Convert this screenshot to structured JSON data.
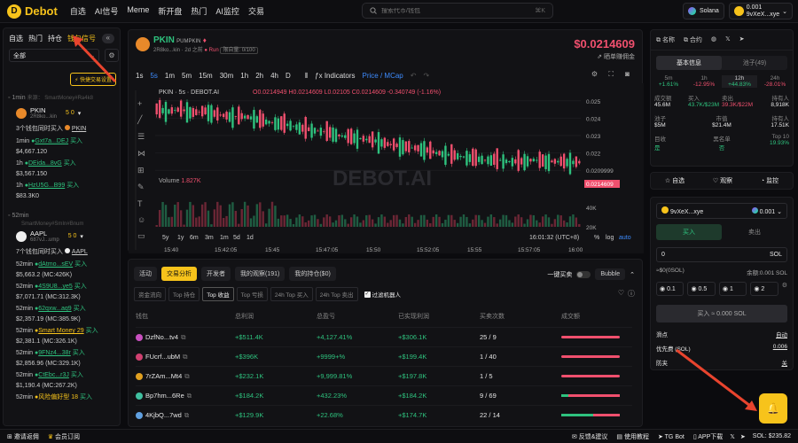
{
  "header": {
    "logo": "Debot",
    "nav": [
      "自选",
      "AI信号",
      "Meme",
      "新开盘",
      "热门",
      "AI监控",
      "交易"
    ],
    "search_placeholder": "搜索代币/钱包",
    "search_kbd": "⌘K",
    "chain": "Solana",
    "wallet_balance": "0.001",
    "wallet_addr": "9vXeX...xye"
  },
  "left": {
    "tabs": [
      "自选",
      "热门",
      "持仓",
      "钱包信号"
    ],
    "toggle": "«",
    "select": "全部",
    "fast_btn": "快捷交易设置",
    "sections": [
      {
        "time": "1min",
        "sub": "来源： SmartMoney#Ra4k8",
        "token": "PKIN",
        "addr": "2R8ko...kin",
        "badge": "5 0",
        "summary": "3个钱包同时买入",
        "summary_token": "PKIN",
        "entries": [
          {
            "t": "1min",
            "w": "Gxt7a...DEJ",
            "a": "买入",
            "amt": "$4,667.120"
          },
          {
            "t": "1h",
            "w": "DEida...8vG",
            "a": "买入",
            "amt": "$3,567.150"
          },
          {
            "t": "1h",
            "w": "HzU5G...B99",
            "a": "买入",
            "amt": "$83.3K0"
          }
        ]
      },
      {
        "time": "52min",
        "sub": "SmartMoney#SmIn#Bnum",
        "token": "AAPL",
        "addr": "687vJ...ump",
        "badge": "5 0",
        "summary": "7个钱包同时买入",
        "summary_token": "AAPL",
        "entries": [
          {
            "t": "52min",
            "w": "dAtmo...sEV",
            "a": "买入",
            "amt": "$5,663.2 (MC:426K)"
          },
          {
            "t": "52min",
            "w": "4S9U8...ye5",
            "a": "买入",
            "amt": "$7,071.71 (MC:312.3K)"
          },
          {
            "t": "52min",
            "w": "62qxw...aq9",
            "a": "买入",
            "amt": "$2,357.19 (MC:385.9K)"
          },
          {
            "t": "52min",
            "w": "Smart Money 29",
            "a": "买入",
            "amt": "$2,381.1 (MC:326.1K)"
          },
          {
            "t": "52min",
            "w": "9FNz4...38r",
            "a": "买入",
            "amt": "$2,856.96 (MC:329.1K)"
          },
          {
            "t": "52min",
            "w": "CtEbc...r3J",
            "a": "买入",
            "amt": "$1,190.4 (MC:267.2K)"
          },
          {
            "t": "52min",
            "w": "风险偏好型 18",
            "a": "买入",
            "amt": ""
          }
        ]
      }
    ]
  },
  "chart": {
    "token": "PKIN",
    "name": "PUMPKIN",
    "age": "2d 之前",
    "addr": "2R8ko...kin",
    "run": "Run",
    "holders_tag": "限自量: 0/100",
    "price": "$0.0214609",
    "rebate": "晒单赚佣金",
    "timeframes": [
      "1s",
      "5s",
      "1m",
      "5m",
      "15m",
      "30m",
      "1h",
      "2h",
      "4h",
      "D"
    ],
    "active_tf": "5s",
    "indicators": "Indicators",
    "price_mcap": "Price / MCap",
    "ohlc_label": "PKIN · 5s · DEBOT.AI",
    "o": "0.0214949",
    "h": "0.0214609",
    "l": "0.02105",
    "c": "0.0214609",
    "chg": "-0.340749 (-1.16%)",
    "watermark": "DEBOT.AI",
    "volume_label": "Volume",
    "volume_val": "1.827K",
    "ymax": "0.025",
    "yticks": [
      "0.025",
      "0.024",
      "0.023",
      "0.022",
      "0.0209999"
    ],
    "current": "0.0214609",
    "vticks": [
      "40K",
      "20K"
    ],
    "xticks": [
      "15:40",
      "15:42:05",
      "15:45",
      "15:47:05",
      "15:50",
      "15:52:05",
      "15:55",
      "15:57:05",
      "16:00"
    ],
    "ranges": [
      "5y",
      "1y",
      "6m",
      "3m",
      "1m",
      "5d",
      "1d"
    ],
    "clock": "16:01:32 (UTC+8)",
    "pct": "%",
    "log": "log",
    "auto": "auto"
  },
  "chart_data": {
    "type": "candlestick",
    "title": "PKIN · 5s · DEBOT.AI",
    "xlabel": "",
    "ylabel": "",
    "xlim": [
      "15:40",
      "16:00"
    ],
    "ylim": [
      0.0205,
      0.0255
    ],
    "close": [
      0.0245,
      0.0244,
      0.0245,
      0.0243,
      0.0244,
      0.0242,
      0.0241,
      0.0241,
      0.024,
      0.0238,
      0.0237,
      0.0236,
      0.0234,
      0.0233,
      0.0232,
      0.023,
      0.0229,
      0.0228,
      0.0227,
      0.0225,
      0.0224,
      0.0223,
      0.0222,
      0.022,
      0.0219,
      0.0218,
      0.0217,
      0.0216,
      0.0216,
      0.0215,
      0.0215,
      0.0216,
      0.0215,
      0.0215,
      0.0214609
    ]
  },
  "bottom": {
    "tabs": [
      "活动",
      "交易分析",
      "开发者",
      "我的观察(191)",
      "我的持仓($0)"
    ],
    "active": 1,
    "toggle_label": "一键买卖",
    "bubble": "Bubble",
    "subtabs": [
      "资金流向",
      "Top 持仓",
      "Top 收益",
      "Top 亏损",
      "24h Top 买入",
      "24h Top 卖出"
    ],
    "active_sub": 2,
    "filter": "过滤机器人",
    "cols": [
      "钱包",
      "总利润",
      "总盈亏",
      "已实现利润",
      "买卖次数",
      "成交额"
    ],
    "rows": [
      {
        "w": "DzfNo...tv4",
        "p": "+$511.4K",
        "pct": "+4,127.41%",
        "r": "+$306.1K",
        "n": "25 / 9"
      },
      {
        "w": "FUcrf...ubM",
        "p": "+$396K",
        "pct": "+9999+%",
        "r": "+$199.4K",
        "n": "1 / 40"
      },
      {
        "w": "7rZAm...Mt4",
        "p": "+$232.1K",
        "pct": "+9,999.81%",
        "r": "+$197.8K",
        "n": "1 / 5"
      },
      {
        "w": "Bp7hm...6Re",
        "p": "+$184.2K",
        "pct": "+432.23%",
        "r": "+$184.2K",
        "n": "9 / 69"
      },
      {
        "w": "4KjbQ...7wd",
        "p": "+$129.9K",
        "pct": "+22.68%",
        "r": "+$174.7K",
        "n": "22 / 14"
      }
    ]
  },
  "right": {
    "actions": [
      "名称",
      "合约"
    ],
    "info_tabs": [
      "基本信息",
      "池子(49)"
    ],
    "periods": [
      {
        "k": "5m",
        "v": "+1.61%"
      },
      {
        "k": "1h",
        "v": "-12.95%"
      },
      {
        "k": "12h",
        "v": "+44.83%"
      },
      {
        "k": "24h",
        "v": "-28.01%"
      }
    ],
    "stats1": [
      {
        "k": "成交额",
        "v": "45.6M"
      },
      {
        "k": "买入",
        "v": "43.7K/$23M"
      },
      {
        "k": "卖出",
        "v": "39.3K/$22M"
      },
      {
        "k": "持有人",
        "v": "8,918K"
      }
    ],
    "stats2": [
      {
        "k": "池子",
        "v": "$5M"
      },
      {
        "k": "市值",
        "v": "$21.4M"
      },
      {
        "k": "持有人",
        "v": "17.51K"
      }
    ],
    "stats3": [
      {
        "k": "目收",
        "v": "是"
      },
      {
        "k": "黑名单",
        "v": "否"
      },
      {
        "k": "Top 10",
        "v": "19.93%"
      }
    ],
    "buttons": [
      "自选",
      "观察",
      "监控"
    ],
    "wallet": "9vXeX...xye",
    "wallet_bal": "0.001",
    "trade_tabs": [
      "买入",
      "卖出"
    ],
    "amount": "0",
    "amount_unit": "SOL",
    "balance_l": "≈$0(0SOL)",
    "balance_r": "余额:0.001 SOL",
    "presets": [
      "0.1",
      "0.5",
      "1",
      "2"
    ],
    "buy_btn": "买入 ≈ 0.000 SOL",
    "opts": [
      {
        "k": "滑点",
        "v": "自动"
      },
      {
        "k": "优先费 (SOL)",
        "v": "0.006"
      },
      {
        "k": "防夹",
        "v": "关"
      }
    ]
  },
  "footer": {
    "invite": "邀请返佣",
    "member": "会员订阅",
    "links": [
      "反馈&建议",
      "使用教程",
      "TG Bot",
      "APP下载"
    ],
    "sol": "SOL: $235.82"
  }
}
